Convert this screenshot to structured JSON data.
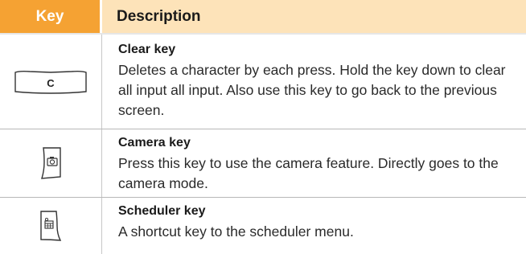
{
  "table": {
    "header": {
      "key": "Key",
      "description": "Description"
    },
    "rows": [
      {
        "icon": "clear-key-icon",
        "key_glyph": "C",
        "title": "Clear key",
        "text": "Deletes a character by each press. Hold the key down to clear all input all input. Also use this key to go back to the previous screen."
      },
      {
        "icon": "camera-key-icon",
        "title": "Camera key",
        "text": "Press this key to use the camera feature. Directly goes to the camera mode."
      },
      {
        "icon": "scheduler-key-icon",
        "title": "Scheduler key",
        "text": "A shortcut key to the scheduler menu."
      }
    ]
  },
  "colors": {
    "header_key_bg": "#f5a233",
    "header_desc_bg": "#fde3b9",
    "row_divider": "#b8b8b8"
  }
}
